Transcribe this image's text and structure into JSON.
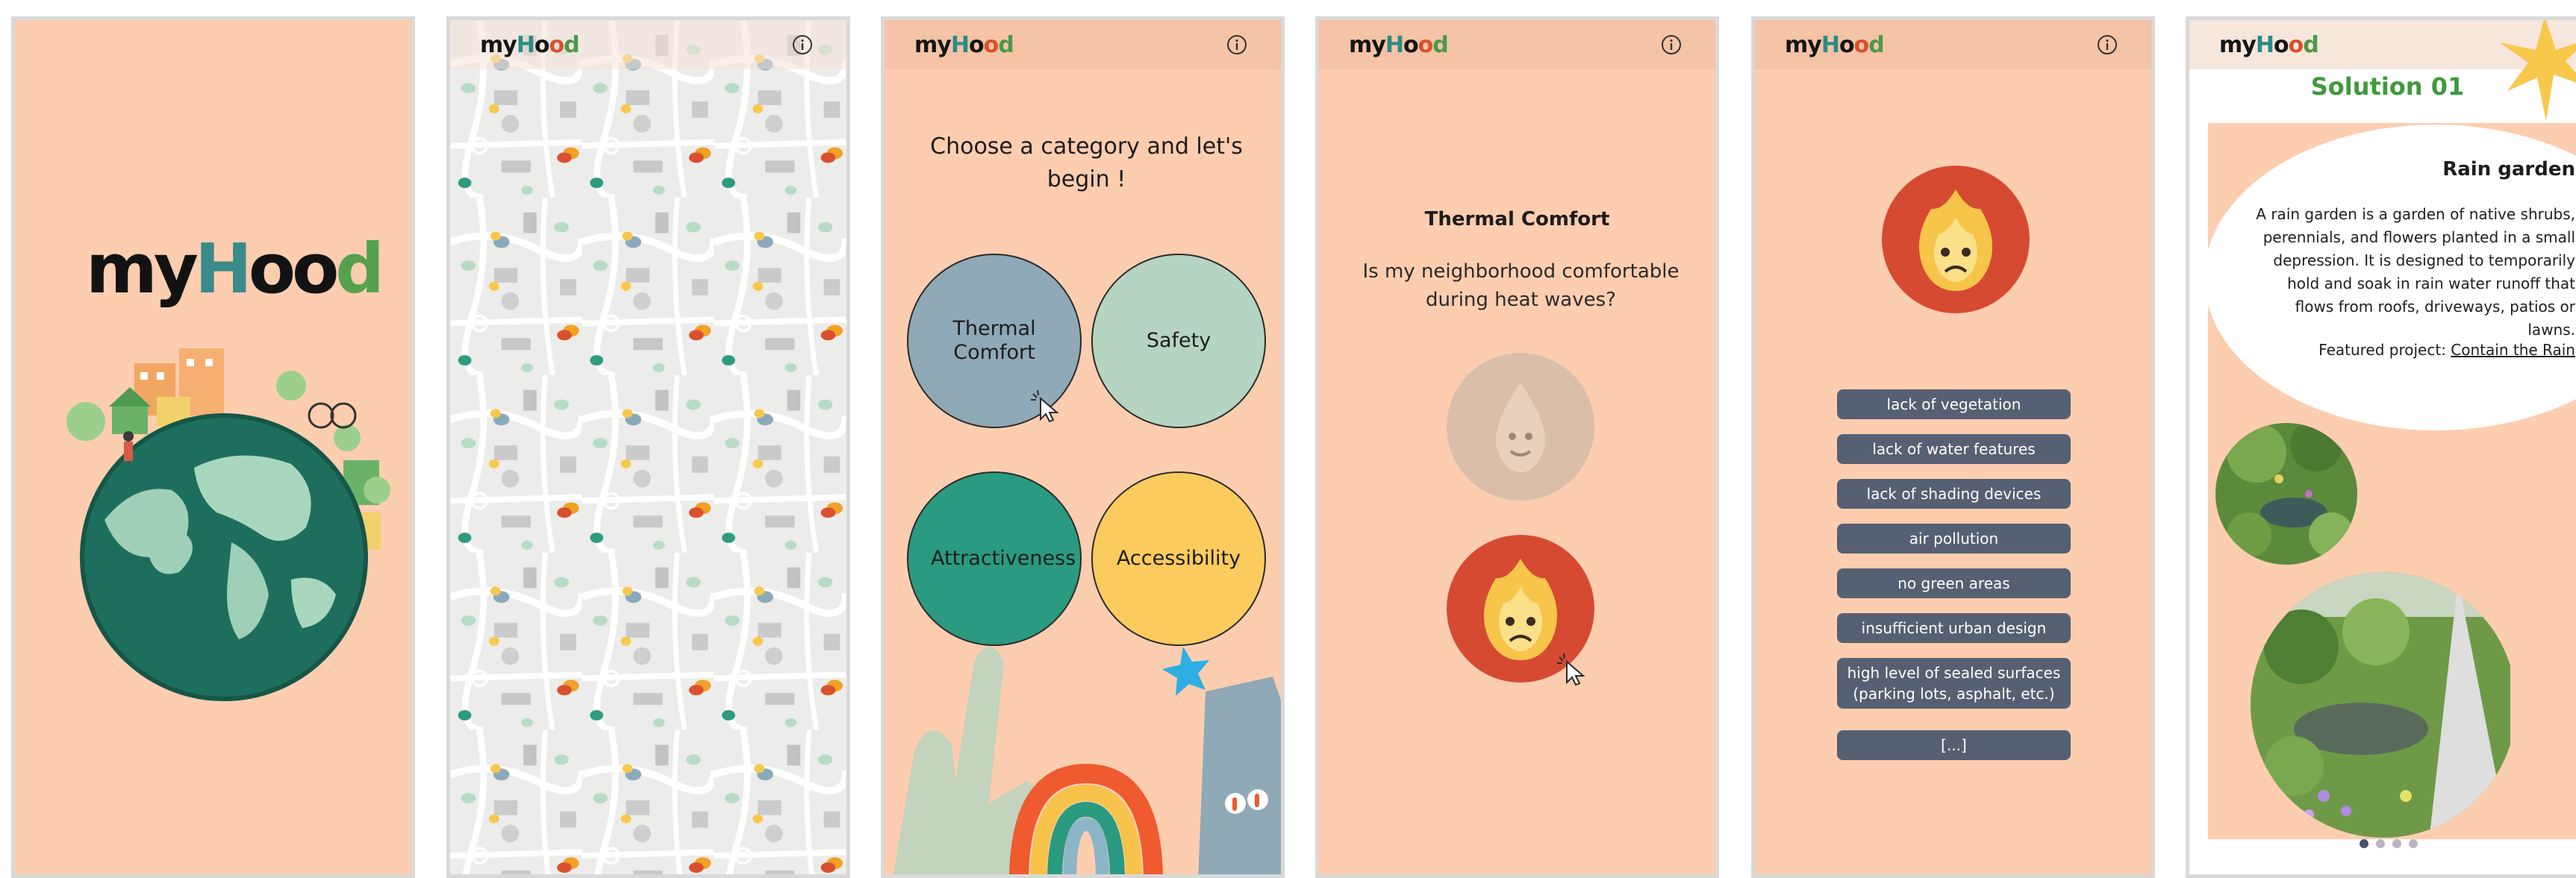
{
  "brand": {
    "p1": "my",
    "h": "H",
    "o1": "o",
    "o2": "o",
    "d": "d"
  },
  "screen1": {
    "logo": {
      "p1": "my",
      "h": "H",
      "o1": "o",
      "o2": "o",
      "d": "d"
    }
  },
  "screen3": {
    "prompt": "Choose a category and let's begin !",
    "categories": [
      {
        "label": "Thermal Comfort",
        "color": "#8fa9b6"
      },
      {
        "label": "Safety",
        "color": "#b5d4c2"
      },
      {
        "label": "Attractiveness",
        "color": "#2a9a80"
      },
      {
        "label": "Accessibility",
        "color": "#fccb5e"
      }
    ]
  },
  "screen4": {
    "title": "Thermal Comfort",
    "question": "Is my neighborhood comfortable during heat waves?",
    "options": [
      {
        "icon": "water-drop-face-icon",
        "color": "#d9bfaa"
      },
      {
        "icon": "sad-flame-face-icon",
        "color": "#d64a32"
      }
    ]
  },
  "screen5": {
    "icon": "sad-flame-face-icon",
    "causes": [
      "lack of vegetation",
      "lack of water features",
      "lack of shading devices",
      "air pollution",
      "no green areas",
      "insufficient urban design",
      "high level of sealed surfaces (parking lots, asphalt, etc.)",
      "[...]"
    ]
  },
  "screen6": {
    "solution_title": "Solution 01",
    "card_title": "Rain garden",
    "description": "A rain garden is a garden of native shrubs, perennials, and flowers planted in a small depression. It is designed to temporarily hold and soak in rain water runoff that flows from roofs, driveways, patios or lawns.",
    "featured_label": "Featured project: ",
    "featured_link": "Contain the Rain",
    "carousel": {
      "count": 4,
      "active": 1
    }
  },
  "colors": {
    "background": "#fdcdb0",
    "topbar": "#f5c3a5",
    "cause_button": "#566072",
    "solution_green": "#3f9a3b",
    "flame_red": "#d64a32"
  }
}
